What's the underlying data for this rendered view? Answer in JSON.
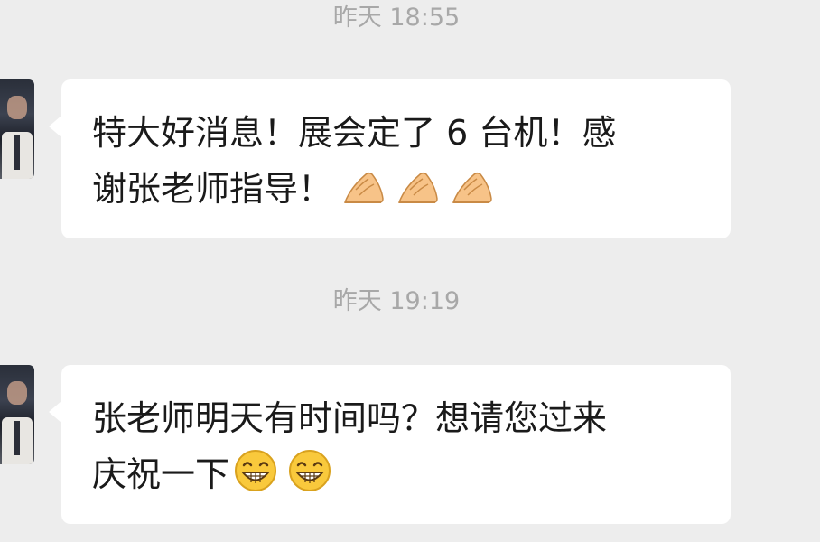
{
  "chat": {
    "messages": [
      {
        "time": "昨天 18:55",
        "line1": "特大好消息！展会定了 6 台机！感",
        "line2": "谢张老师指导！",
        "emojis": [
          "praying-hands-icon",
          "praying-hands-icon",
          "praying-hands-icon"
        ]
      },
      {
        "time": "昨天 19:19",
        "line1": "张老师明天有时间吗？想请您过来",
        "line2": "庆祝一下",
        "emojis": [
          "grinning-face-icon",
          "grinning-face-icon"
        ]
      }
    ]
  },
  "colors": {
    "background": "#ededed",
    "bubble": "#ffffff",
    "timestamp": "#a8a8a8",
    "text": "#1a1a1a"
  }
}
